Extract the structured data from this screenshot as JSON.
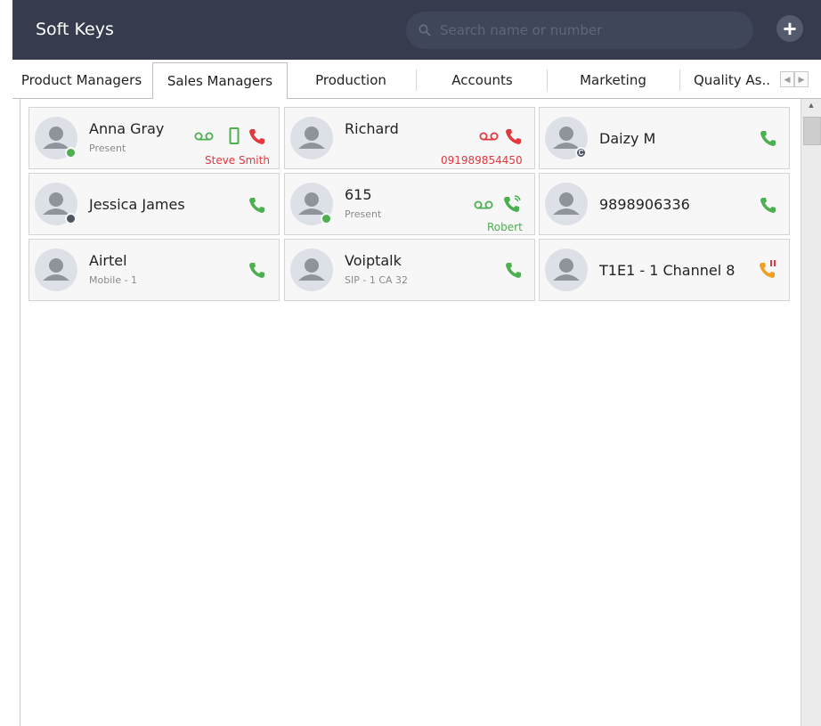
{
  "app": {
    "title": "Soft Keys"
  },
  "search": {
    "placeholder": "Search name or number"
  },
  "add_button": {
    "label": "+"
  },
  "tabs": [
    {
      "label": "Product Managers"
    },
    {
      "label": "Sales Managers",
      "active": true
    },
    {
      "label": "Production"
    },
    {
      "label": "Accounts"
    },
    {
      "label": "Marketing"
    },
    {
      "label": "Quality As.."
    }
  ],
  "tab_nav": {
    "prev": "◀",
    "next": "▶"
  },
  "contacts": [
    {
      "name": "Anna Gray",
      "status": "Present",
      "call_info": "Steve Smith",
      "presence": "present",
      "icons": [
        "voicemail-icon",
        "mobile-icon",
        "phone-red-icon"
      ]
    },
    {
      "name": "Richard",
      "status": "",
      "call_info": "091989854450",
      "icons": [
        "voicemail-icon",
        "phone-red-icon"
      ]
    },
    {
      "name": "Daizy M",
      "status": "",
      "presence_badge": "C",
      "icons": [
        "phone-green-icon"
      ]
    },
    {
      "name": "Jessica James",
      "status": "",
      "presence_badge": "busy",
      "icons": [
        "phone-green-icon"
      ]
    },
    {
      "name": "615",
      "status": "Present",
      "call_info": "Robert",
      "presence": "present",
      "icons": [
        "voicemail-icon",
        "phone-ringing-icon"
      ]
    },
    {
      "name": "9898906336",
      "status": "",
      "icons": [
        "phone-green-icon"
      ]
    },
    {
      "name": "Airtel",
      "status": "Mobile - 1",
      "icons": [
        "phone-green-icon"
      ]
    },
    {
      "name": "Voiptalk",
      "status": "SIP - 1 CA 32",
      "icons": [
        "phone-green-icon"
      ]
    },
    {
      "name": "T1E1 - 1 Channel 8",
      "status": "",
      "icons": [
        "phone-alert-icon"
      ]
    }
  ],
  "colors": {
    "titlebar": "#363c4e",
    "green": "#4caf50",
    "red": "#e0393e",
    "orange": "#f0a020"
  },
  "scrollbar": {
    "up": "▲"
  }
}
